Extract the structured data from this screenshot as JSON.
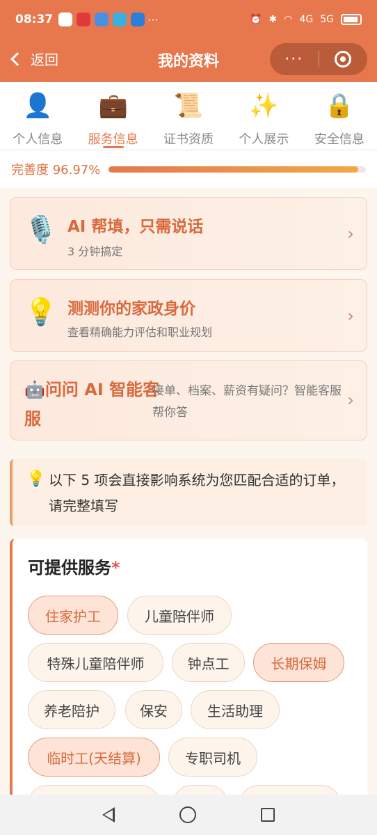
{
  "status_bar": {
    "time": "08:37",
    "more": "···",
    "signal_1": "4G",
    "signal_2": "5G"
  },
  "nav": {
    "back_label": "返回",
    "title": "我的资料",
    "more_icon": "···"
  },
  "tabs": [
    {
      "label": "个人信息",
      "icon": "👤",
      "icon_name": "person-icon",
      "active": false
    },
    {
      "label": "服务信息",
      "icon": "💼",
      "icon_name": "briefcase-icon",
      "active": true
    },
    {
      "label": "证书资质",
      "icon": "📜",
      "icon_name": "scroll-icon",
      "active": false
    },
    {
      "label": "个人展示",
      "icon": "✨",
      "icon_name": "sparkles-icon",
      "active": false
    },
    {
      "label": "安全信息",
      "icon": "🔒",
      "icon_name": "lock-icon",
      "active": false
    }
  ],
  "progress": {
    "label": "完善度 96.97%",
    "value": 96.97
  },
  "cards": {
    "ai_fill": {
      "icon": "🎙️",
      "title": "AI 帮填，只需说话",
      "subtitle": "3 分钟搞定",
      "arrow": "›"
    },
    "value_test": {
      "icon": "💡",
      "title": "测测你的家政身价",
      "subtitle": "查看精确能力评估和职业规划",
      "arrow": "›"
    },
    "ai_service": {
      "icon": "🤖",
      "title": "问问 AI 智能客服",
      "subtitle": "接单、档案、薪资有疑问？智能客服帮你答",
      "arrow": "›"
    }
  },
  "notice": {
    "icon": "💡",
    "text": "以下 5 项会直接影响系统为您匹配合适的订单，请完整填写"
  },
  "services": {
    "title": "可提供服务",
    "required_mark": "*",
    "chips": [
      {
        "label": "住家护工",
        "selected": true
      },
      {
        "label": "儿童陪伴师",
        "selected": false
      },
      {
        "label": "特殊儿童陪伴师",
        "selected": false
      },
      {
        "label": "钟点工",
        "selected": false
      },
      {
        "label": "长期保姆",
        "selected": true
      },
      {
        "label": "养老陪护",
        "selected": false
      },
      {
        "label": "保安",
        "selected": false
      },
      {
        "label": "生活助理",
        "selected": false
      },
      {
        "label": "临时工(天结算)",
        "selected": true
      },
      {
        "label": "专职司机",
        "selected": false
      }
    ]
  },
  "colors": {
    "brand": "#e7784e",
    "accent_text": "#d9693d",
    "background": "#fdf6ef"
  }
}
